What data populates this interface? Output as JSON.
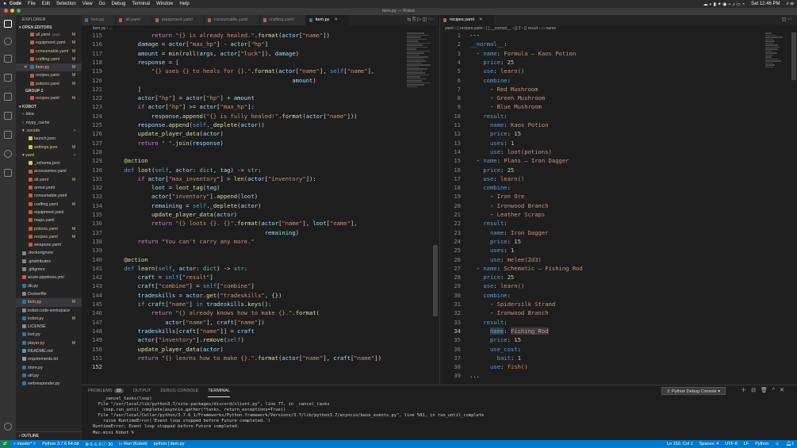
{
  "menubar": {
    "items": [
      "Code",
      "File",
      "Edit",
      "Selection",
      "View",
      "Go",
      "Debug",
      "Terminal",
      "Window",
      "Help"
    ],
    "clock": "Sat 12:46 PM"
  },
  "window_title": "item.py — Kobot",
  "sidebar": {
    "header": "EXPLORER",
    "open_editors_label": "OPEN EDITORS",
    "open_editors": [
      {
        "name": "all.yaml",
        "hint": "yaml",
        "mark": "M"
      },
      {
        "name": "equipment.yaml",
        "mark": "M"
      },
      {
        "name": "consumable.yaml",
        "mark": "M"
      },
      {
        "name": "crafting.yaml",
        "mark": "M"
      },
      {
        "name": "item.py",
        "mark": "M"
      },
      {
        "name": "recipes.yaml",
        "mark": "M"
      },
      {
        "name": "potions.yaml",
        "mark": "M"
      }
    ],
    "group2_label": "GROUP 2",
    "group2": [
      {
        "name": "recipes.yaml",
        "mark": "M"
      }
    ],
    "project_label": "KOBOT",
    "tree": [
      {
        "name": ".idea",
        "mark": ""
      },
      {
        "name": ".mypy_cache",
        "mark": ""
      },
      {
        "name": ".vscode",
        "mark": "•"
      },
      {
        "name": "launch.json",
        "mark": ""
      },
      {
        "name": "settings.json",
        "mark": "M"
      },
      {
        "name": "yaml",
        "mark": "•"
      },
      {
        "name": "_schema.json",
        "mark": ""
      },
      {
        "name": "accessories.yaml",
        "mark": ""
      },
      {
        "name": "all.yaml",
        "mark": "M"
      },
      {
        "name": "armor.yaml",
        "mark": ""
      },
      {
        "name": "consumable.yaml",
        "mark": ""
      },
      {
        "name": "crafting.yaml",
        "mark": "M"
      },
      {
        "name": "equipment.yaml",
        "mark": ""
      },
      {
        "name": "maps.yaml",
        "mark": ""
      },
      {
        "name": "potions.yaml",
        "mark": "M"
      },
      {
        "name": "recipes.yaml",
        "mark": "M"
      },
      {
        "name": "weapons.yaml",
        "mark": ""
      },
      {
        "name": ".dockerignore",
        "mark": ""
      },
      {
        "name": ".gitattributes",
        "mark": ""
      },
      {
        "name": ".gitignore",
        "mark": ""
      },
      {
        "name": "azure-pipelines.yml",
        "mark": ""
      },
      {
        "name": "db.py",
        "mark": ""
      },
      {
        "name": "Dockerfile",
        "mark": ""
      },
      {
        "name": "item.py",
        "mark": "M"
      },
      {
        "name": "kobot.code-workspace",
        "mark": ""
      },
      {
        "name": "kobot.py",
        "mark": "M"
      },
      {
        "name": "LICENSE",
        "mark": ""
      },
      {
        "name": "loot.py",
        "mark": ""
      },
      {
        "name": "player.py",
        "mark": "M"
      },
      {
        "name": "README.md",
        "mark": ""
      },
      {
        "name": "requirements.txt",
        "mark": ""
      },
      {
        "name": "store.py",
        "mark": ""
      },
      {
        "name": "util.py",
        "mark": ""
      },
      {
        "name": "webresponder.py",
        "mark": ""
      }
    ],
    "outline_label": "OUTLINE"
  },
  "editor1": {
    "tabs": [
      {
        "label": "loot.py",
        "active": false
      },
      {
        "label": "all.yaml",
        "active": false
      },
      {
        "label": "equipment.yaml",
        "active": false
      },
      {
        "label": "consumable.yaml",
        "active": false
      },
      {
        "label": "crafting.yaml",
        "active": false
      },
      {
        "label": "item.py",
        "active": true
      }
    ],
    "breadcrumb": "item.py › ..."
  },
  "editor2": {
    "tabs": [
      {
        "label": "recipes.yaml",
        "active": true
      }
    ],
    "breadcrumb": "yaml › ▯ recipes.yaml › [ ] __normal__ › {} 2 › {} result › ▭ name"
  },
  "panel": {
    "tabs": [
      {
        "label": "PROBLEMS",
        "badge": "30"
      },
      {
        "label": "OUTPUT"
      },
      {
        "label": "DEBUG CONSOLE"
      },
      {
        "label": "TERMINAL",
        "active": true
      }
    ],
    "terminal_select": "2: Python Debug Console",
    "terminal_lines": [
      "    _cancel_tasks(loop)",
      "  File \"/usr/local/lib/python3.7/site-packages/discord/client.py\", line 77, in _cancel_tasks",
      "    loop.run_until_complete(asyncio.gather(*tasks, return_exceptions=True))",
      "  File \"/usr/local/Cellar/python/3.7.6_1/Frameworks/Python.framework/Versions/3.7/lib/python3.7/asyncio/base_events.py\", line 581, in run_until_complete",
      "    raise RuntimeError('Event loop stopped before Future completed.')",
      "RuntimeError: Event loop stopped before Future completed.",
      "Mac-mini Kobot % "
    ]
  },
  "statusbar": {
    "branch": "master*",
    "python": "Python 3.7.6 64-bit",
    "problems": "⊗ 0 ⚠ 0 ⓘ 30",
    "run": "Run (Kobot)",
    "file": "python | item.py",
    "position": "Ln 152, Col 1",
    "spaces": "Spaces: 4",
    "encoding": "UTF-8",
    "eol": "LF",
    "language": "Python"
  },
  "colors": {
    "accent": "#007acc",
    "keyword": "#c586c0",
    "string": "#ce9178",
    "function": "#dcdcaa",
    "variable": "#9cdcfe",
    "yaml_key": "#569cd6"
  }
}
